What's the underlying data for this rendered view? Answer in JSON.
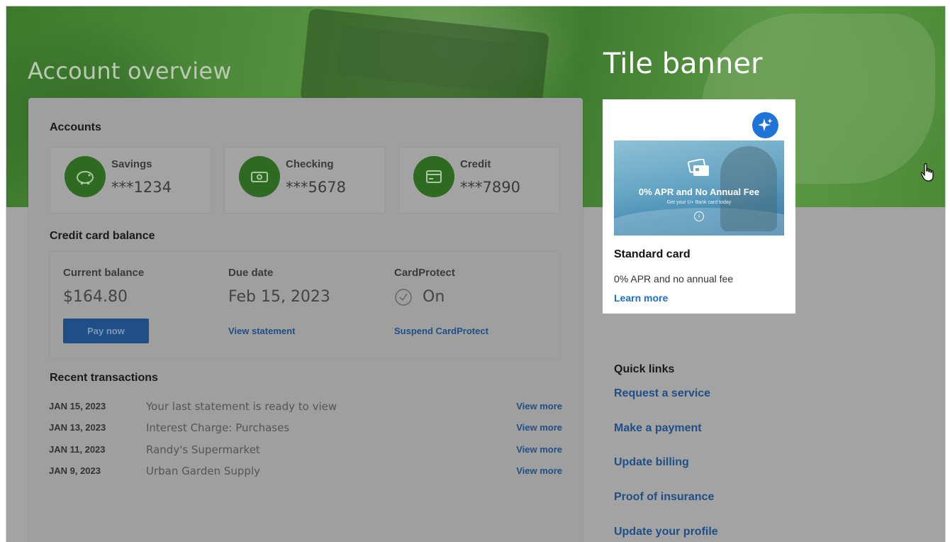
{
  "page": {
    "title": "Account overview",
    "banner_title": "Tile banner"
  },
  "accounts": {
    "heading": "Accounts",
    "items": [
      {
        "name": "Savings",
        "number": "***1234",
        "icon": "piggy-bank-icon"
      },
      {
        "name": "Checking",
        "number": "***5678",
        "icon": "cash-icon"
      },
      {
        "name": "Credit",
        "number": "***7890",
        "icon": "credit-card-icon"
      }
    ]
  },
  "credit_balance": {
    "heading": "Credit card balance",
    "current_balance_label": "Current balance",
    "current_balance_value": "$164.80",
    "pay_button": "Pay now",
    "due_date_label": "Due date",
    "due_date_value": "Feb 15, 2023",
    "view_statement": "View statement",
    "cardprotect_label": "CardProtect",
    "cardprotect_value": "On",
    "suspend_link": "Suspend CardProtect"
  },
  "transactions": {
    "heading": "Recent transactions",
    "rows": [
      {
        "date": "JAN 15, 2023",
        "description": "Your last statement is ready to view",
        "link": "View more"
      },
      {
        "date": "JAN 13, 2023",
        "description": "Interest Charge: Purchases",
        "link": "View more"
      },
      {
        "date": "JAN 11, 2023",
        "description": "Randy's Supermarket",
        "link": "View more"
      },
      {
        "date": "JAN 9, 2023",
        "description": "Urban Garden Supply",
        "link": "View more"
      }
    ]
  },
  "tile": {
    "promo_headline": "0% APR and No Annual Fee",
    "promo_subline": "Get your U+ Bank card today",
    "title": "Standard card",
    "description": "0% APR and no annual fee",
    "link": "Learn more",
    "accent_color": "#1f73d8"
  },
  "quick_links": {
    "title": "Quick links",
    "items": [
      "Request a service",
      "Make a payment",
      "Update billing",
      "Proof of insurance",
      "Update your profile"
    ]
  },
  "colors": {
    "brand_green": "#2f6a23",
    "link_blue": "#1f4f86",
    "button_blue": "#1f4f86"
  }
}
